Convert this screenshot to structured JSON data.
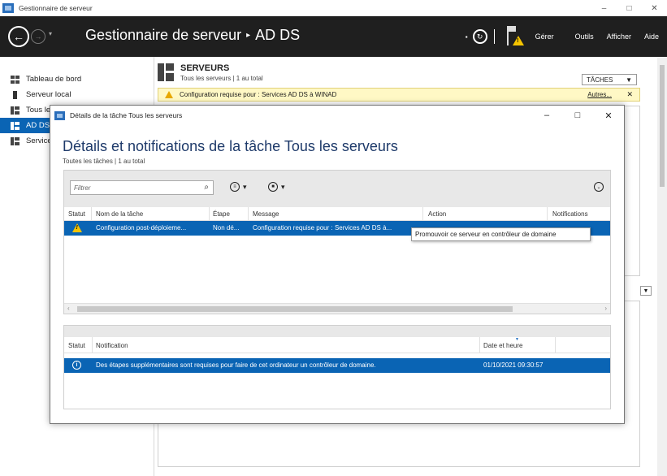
{
  "window": {
    "title": "Gestionnaire de serveur",
    "controls": {
      "minimize": "–",
      "maximize": "□",
      "close": "✕"
    }
  },
  "header": {
    "title": "Gestionnaire de serveur",
    "separator": "▸",
    "section": "AD DS",
    "menus": [
      "Gérer",
      "Outils",
      "Afficher",
      "Aide"
    ]
  },
  "sidebar": {
    "items": [
      {
        "label": "Tableau de bord",
        "icon": "dashboard-grid-icon"
      },
      {
        "label": "Serveur local",
        "icon": "server-icon"
      },
      {
        "label": "Tous les serveurs",
        "icon": "servers-icon"
      },
      {
        "label": "AD DS",
        "icon": "ad-ds-icon",
        "active": true
      },
      {
        "label": "Services de fichiers et de stockage",
        "icon": "file-services-icon"
      }
    ]
  },
  "main": {
    "servers_title": "SERVEURS",
    "servers_sub": "Tous les serveurs | 1 au total",
    "tasks_button": "TÂCHES",
    "warning_text": "Configuration requise pour : Services AD DS à WINAD",
    "warning_link": "Autres...",
    "warning_close": "✕"
  },
  "dialog": {
    "title": "Détails de la tâche Tous les serveurs",
    "heading": "Détails et notifications de la tâche Tous les serveurs",
    "subheading": "Toutes les tâches | 1 au total",
    "filter_placeholder": "Filtrer",
    "columns": {
      "statut": "Statut",
      "nom": "Nom de la tâche",
      "etape": "Étape",
      "message": "Message",
      "action": "Action",
      "notifications": "Notifications"
    },
    "task": {
      "nom": "Configuration post-déploieme...",
      "etape": "Non dé...",
      "message": "Configuration requise pour : Services AD DS à...",
      "action": "Promouvoir ce serveur en contrôleur de domaine"
    },
    "notif_columns": {
      "statut": "Statut",
      "notification": "Notification",
      "date": "Date et heure"
    },
    "notification": {
      "text": "Des étapes supplémentaires sont requises pour faire de cet ordinateur un contrôleur de domaine.",
      "date": "01/10/2021 09:30:57"
    }
  }
}
